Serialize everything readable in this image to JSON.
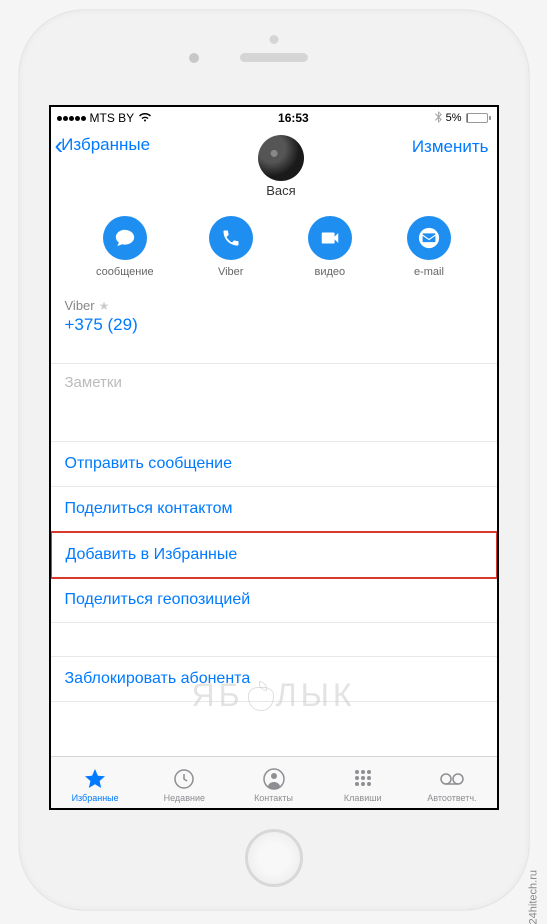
{
  "status_bar": {
    "carrier": "MTS BY",
    "time": "16:53",
    "battery_percent": "5%"
  },
  "nav": {
    "back_label": "Избранные",
    "edit_label": "Изменить",
    "contact_name": "Вася"
  },
  "actions": {
    "message": "сообщение",
    "viber": "Viber",
    "video": "видео",
    "email": "e-mail"
  },
  "phone_section": {
    "label": "Viber",
    "number": "+375 (29)"
  },
  "notes": {
    "placeholder": "Заметки"
  },
  "list": {
    "send_message": "Отправить сообщение",
    "share_contact": "Поделиться контактом",
    "add_favorite": "Добавить в Избранные",
    "share_location": "Поделиться геопозицией",
    "block": "Заблокировать абонента"
  },
  "tabs": {
    "favorites": "Избранные",
    "recents": "Недавние",
    "contacts": "Контакты",
    "keypad": "Клавиши",
    "voicemail": "Автоответч."
  },
  "watermarks": {
    "outer": "24hitech.ru",
    "inner_left": "ЯБ",
    "inner_right": "ЛЫК"
  }
}
